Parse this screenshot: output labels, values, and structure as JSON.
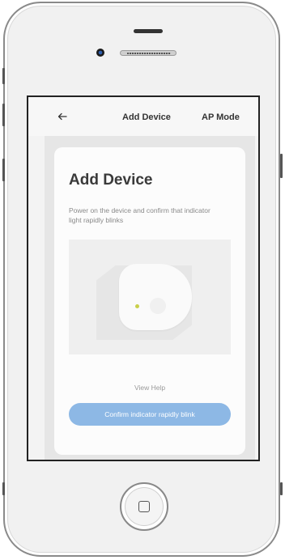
{
  "app": {
    "back_icon": "arrow-left-icon",
    "title": "Add Device",
    "mode_label": "AP Mode"
  },
  "card": {
    "heading": "Add Device",
    "description": "Power on the device and confirm that indicator light rapidly blinks",
    "help_link": "View Help",
    "confirm_label": "Confirm indicator rapidly blink"
  },
  "device": {
    "home_icon": "home-button-icon"
  },
  "colors": {
    "accent_button": "#8db8e5",
    "indicator_light": "#c9cf4a"
  }
}
